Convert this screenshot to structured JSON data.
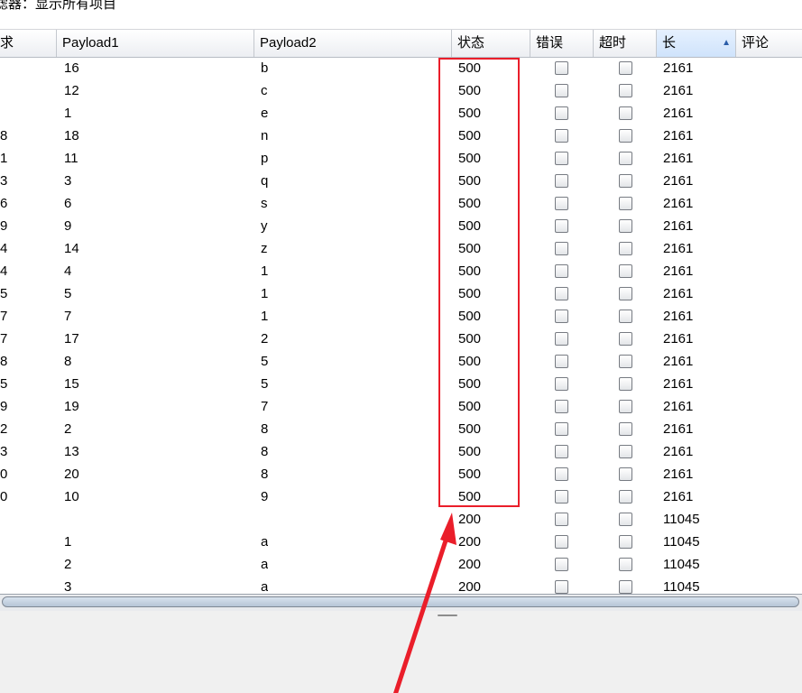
{
  "filter": {
    "label": "滤器：显示所有项目"
  },
  "table": {
    "columns": [
      {
        "label": "求"
      },
      {
        "label": "Payload1"
      },
      {
        "label": "Payload2"
      },
      {
        "label": "状态"
      },
      {
        "label": "错误"
      },
      {
        "label": "超时"
      },
      {
        "label": "长"
      },
      {
        "label": "评论"
      }
    ],
    "sorted_column": "长",
    "sort_direction": "ascending",
    "rows": [
      {
        "req": "",
        "p1": "16",
        "p2": "b",
        "status": "500",
        "error": false,
        "timeout": false,
        "length": "2161"
      },
      {
        "req": "",
        "p1": "12",
        "p2": "c",
        "status": "500",
        "error": false,
        "timeout": false,
        "length": "2161"
      },
      {
        "req": "",
        "p1": "1",
        "p2": "e",
        "status": "500",
        "error": false,
        "timeout": false,
        "length": "2161"
      },
      {
        "req": "8",
        "p1": "18",
        "p2": "n",
        "status": "500",
        "error": false,
        "timeout": false,
        "length": "2161"
      },
      {
        "req": "1",
        "p1": "11",
        "p2": "p",
        "status": "500",
        "error": false,
        "timeout": false,
        "length": "2161"
      },
      {
        "req": "3",
        "p1": "3",
        "p2": "q",
        "status": "500",
        "error": false,
        "timeout": false,
        "length": "2161"
      },
      {
        "req": "6",
        "p1": "6",
        "p2": "s",
        "status": "500",
        "error": false,
        "timeout": false,
        "length": "2161"
      },
      {
        "req": "9",
        "p1": "9",
        "p2": "y",
        "status": "500",
        "error": false,
        "timeout": false,
        "length": "2161"
      },
      {
        "req": "4",
        "p1": "14",
        "p2": "z",
        "status": "500",
        "error": false,
        "timeout": false,
        "length": "2161"
      },
      {
        "req": "4",
        "p1": "4",
        "p2": "1",
        "status": "500",
        "error": false,
        "timeout": false,
        "length": "2161"
      },
      {
        "req": "5",
        "p1": "5",
        "p2": "1",
        "status": "500",
        "error": false,
        "timeout": false,
        "length": "2161"
      },
      {
        "req": "7",
        "p1": "7",
        "p2": "1",
        "status": "500",
        "error": false,
        "timeout": false,
        "length": "2161"
      },
      {
        "req": "7",
        "p1": "17",
        "p2": "2",
        "status": "500",
        "error": false,
        "timeout": false,
        "length": "2161"
      },
      {
        "req": "8",
        "p1": "8",
        "p2": "5",
        "status": "500",
        "error": false,
        "timeout": false,
        "length": "2161"
      },
      {
        "req": "5",
        "p1": "15",
        "p2": "5",
        "status": "500",
        "error": false,
        "timeout": false,
        "length": "2161"
      },
      {
        "req": "9",
        "p1": "19",
        "p2": "7",
        "status": "500",
        "error": false,
        "timeout": false,
        "length": "2161"
      },
      {
        "req": "2",
        "p1": "2",
        "p2": "8",
        "status": "500",
        "error": false,
        "timeout": false,
        "length": "2161"
      },
      {
        "req": "3",
        "p1": "13",
        "p2": "8",
        "status": "500",
        "error": false,
        "timeout": false,
        "length": "2161"
      },
      {
        "req": "0",
        "p1": "20",
        "p2": "8",
        "status": "500",
        "error": false,
        "timeout": false,
        "length": "2161"
      },
      {
        "req": "0",
        "p1": "10",
        "p2": "9",
        "status": "500",
        "error": false,
        "timeout": false,
        "length": "2161"
      },
      {
        "req": "",
        "p1": "",
        "p2": "",
        "status": "200",
        "error": false,
        "timeout": false,
        "length": "11045"
      },
      {
        "req": "",
        "p1": "1",
        "p2": "a",
        "status": "200",
        "error": false,
        "timeout": false,
        "length": "11045"
      },
      {
        "req": "",
        "p1": "2",
        "p2": "a",
        "status": "200",
        "error": false,
        "timeout": false,
        "length": "11045"
      },
      {
        "req": "",
        "p1": "3",
        "p2": "a",
        "status": "200",
        "error": false,
        "timeout": false,
        "length": "11045"
      }
    ]
  },
  "annotation": {
    "highlight_color": "#ea1e2a"
  }
}
